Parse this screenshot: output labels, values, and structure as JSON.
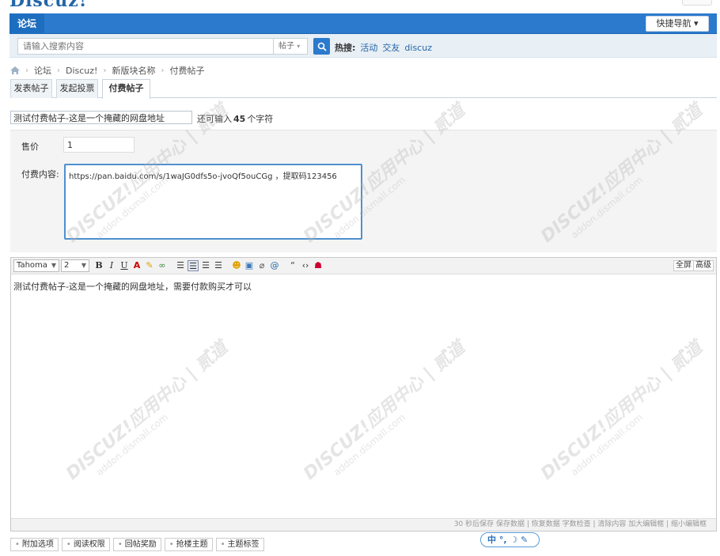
{
  "logo": {
    "text": "Discuz!"
  },
  "navbar": {
    "tab": "论坛",
    "quick_nav": "快捷导航 ▾"
  },
  "search": {
    "placeholder": "请输入搜索内容",
    "type": "帖子",
    "hot_label": "热搜:",
    "hot_items": [
      "活动",
      "交友",
      "discuz"
    ]
  },
  "breadcrumb": [
    "论坛",
    "Discuz!",
    "新版块名称",
    "付费帖子"
  ],
  "tabs": [
    "发表帖子",
    "发起投票",
    "付费帖子"
  ],
  "subject": {
    "value": "测试付费帖子-这是一个掩藏的网盘地址",
    "count_prefix": "还可输入",
    "count_value": "45",
    "count_suffix": "个字符"
  },
  "paid": {
    "price_label": "售价",
    "price_value": "1",
    "content_label": "付费内容:",
    "content_value": "https://pan.baidu.com/s/1waJG0dfs5o-jvoQf5ouCGg ，提取码123456"
  },
  "editor": {
    "font": "Tahoma",
    "size": "2",
    "fullscreen": "全屏",
    "advanced": "高级",
    "body": "测试付费帖子-这是一个掩藏的网盘地址，需要付款购买才可以",
    "status": "30 秒后保存 保存数据 | 恢复数据   字数检查 | 清除内容   加大编辑框 | 缩小编辑框"
  },
  "options": [
    "附加选项",
    "阅读权限",
    "回帖奖励",
    "抢楼主题",
    "主题标签"
  ],
  "ime": {
    "text": "中 °, ☽ ✎"
  },
  "watermark": {
    "main": "DISCUZ!应用中心 | 贰道",
    "sub": "addon.dismall.com"
  },
  "colors": {
    "nav": "#2b7acd",
    "accent_border": "#4f8fce"
  }
}
